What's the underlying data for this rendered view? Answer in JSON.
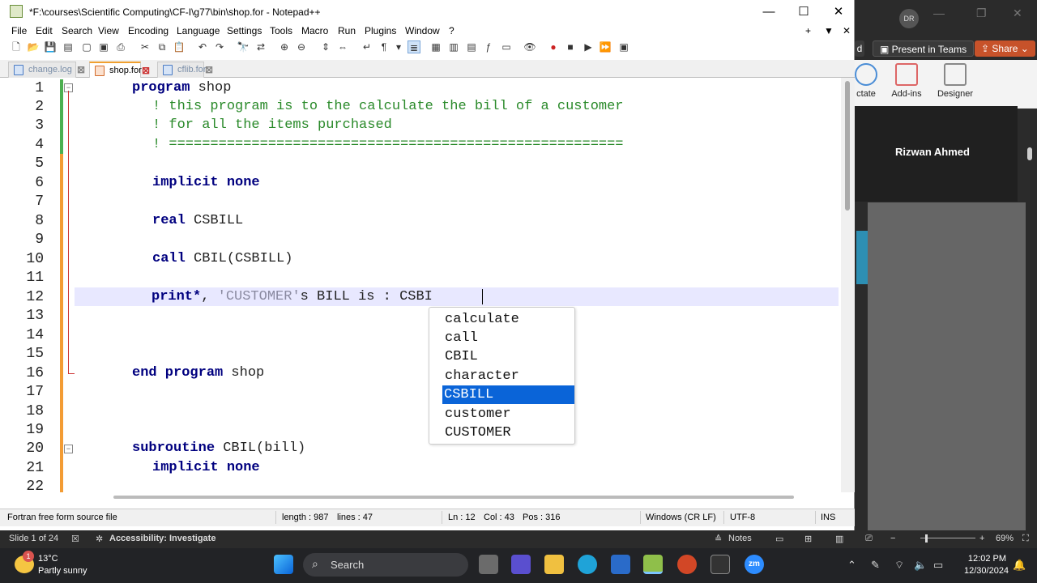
{
  "window": {
    "title": "*F:\\courses\\Scientific Computing\\CF-I\\g77\\bin\\shop.for - Notepad++"
  },
  "menu": [
    "File",
    "Edit",
    "Search",
    "View",
    "Encoding",
    "Language",
    "Settings",
    "Tools",
    "Macro",
    "Run",
    "Plugins",
    "Window",
    "?"
  ],
  "menu_extra": {
    "plus": "+",
    "down": "▼",
    "close": "✕"
  },
  "tabs": [
    {
      "label": "change.log"
    },
    {
      "label": "shop.for"
    },
    {
      "label": "cflib.for"
    }
  ],
  "line_numbers": [
    "1",
    "2",
    "3",
    "4",
    "5",
    "6",
    "7",
    "8",
    "9",
    "10",
    "11",
    "12",
    "13",
    "14",
    "15",
    "16",
    "17",
    "18",
    "19",
    "20",
    "21",
    "22"
  ],
  "code": {
    "l1_kw": "program",
    "l1_rest": " shop",
    "l2": "! this program is to the calculate the bill of a customer",
    "l3": "! for all the items purchased",
    "l4": "! =======================================================",
    "l6": "implicit none",
    "l8_kw": "real",
    "l8_rest": " CSBILL",
    "l10_kw": "call",
    "l10_rest": " CBIL(CSBILL)",
    "l12_kw": "print*",
    "l12_p": ", ",
    "l12_str": "'CUSTOMER'",
    "l12_rest": "s BILL is : CSBI",
    "l16_kw": "end program",
    "l16_rest": " shop",
    "l20_kw": "subroutine",
    "l20_rest": " CBIL(bill)",
    "l21": "implicit none"
  },
  "autocomplete": {
    "items": [
      "calculate",
      "call",
      "CBIL",
      "character",
      "CSBILL",
      "customer",
      "CUSTOMER"
    ],
    "selected": "CSBILL"
  },
  "statusbar": {
    "filetype": "Fortran free form source file",
    "length": "length : 987",
    "lines": "lines : 47",
    "ln": "Ln : 12",
    "col": "Col : 43",
    "pos": "Pos : 316",
    "eol": "Windows (CR LF)",
    "encoding": "UTF-8",
    "mode": "INS"
  },
  "background_app": {
    "avatar": "DR",
    "partial_label": "d",
    "present_in_teams": "Present in Teams",
    "share": "Share",
    "ribbon": {
      "dictate": "ctate",
      "addins": "Add-ins",
      "designer": "Designer"
    },
    "presenter_name": "Rizwan Ahmed",
    "slide_info": "Slide 1 of 24",
    "accessibility": "Accessibility: Investigate",
    "notes": "Notes",
    "zoom": "69%"
  },
  "taskbar": {
    "weather_temp": "13°C",
    "weather_desc": "Partly sunny",
    "weather_badge": "1",
    "search": "Search",
    "time": "12:02 PM",
    "date": "12/30/2024",
    "zoom_label": "zm"
  },
  "colors": {
    "accent": "#0a64d8",
    "keyword": "#00007f",
    "comment": "#2a8a2a",
    "current_line": "#e8e8ff"
  }
}
